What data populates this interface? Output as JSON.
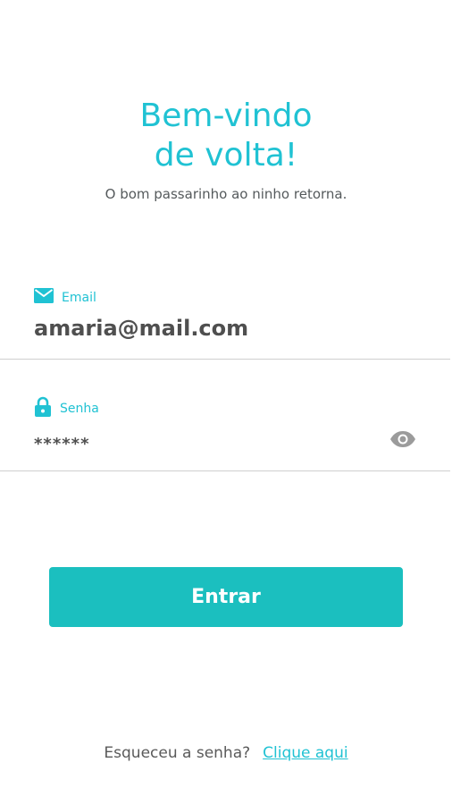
{
  "header": {
    "title_line1": "Bem-vindo",
    "title_line2": "de volta!",
    "subtitle": "O bom passarinho ao ninho retorna."
  },
  "email": {
    "label": "Email",
    "value": "amaria@mail.com",
    "icon": "mail-icon"
  },
  "password": {
    "label": "Senha",
    "value": "******",
    "icon": "lock-icon",
    "toggle_icon": "eye-icon"
  },
  "login_button": {
    "label": "Entrar"
  },
  "forgot": {
    "text": "Esqueceu a senha?",
    "link": "Clique aqui"
  },
  "colors": {
    "accent": "#20c2d3",
    "button": "#1bbfbf",
    "text": "#4f4f4f",
    "divider": "#cfcfcf"
  }
}
